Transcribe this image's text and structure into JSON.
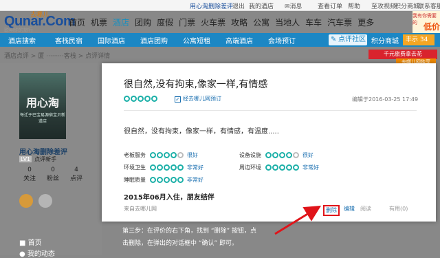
{
  "topbar": {
    "user_link": "用心淘删除差评",
    "logout": "退出",
    "my_hotel": "我的酒店",
    "messages": "消息",
    "orders": "查看订单",
    "help": "帮助",
    "video": "至攻视频",
    "points": "积分商城",
    "contact": "联系客服"
  },
  "logo": {
    "brand": "Qunar.Com",
    "camel": "去哪儿",
    "tagline": "聪明你的旅行"
  },
  "main_nav": [
    "首页",
    "机票",
    "酒店",
    "团购",
    "度假",
    "门票",
    "火车票",
    "攻略",
    "公寓",
    "当地人",
    "车车",
    "汽车票",
    "更多"
  ],
  "main_nav_active": "酒店",
  "promo": {
    "small": "我有你需要的",
    "big": "低价"
  },
  "sub_nav": {
    "items": [
      "酒店搜索",
      "客栈民宿",
      "国际酒店",
      "酒店团购",
      "公寓短租",
      "高端酒店",
      "会场预订"
    ],
    "review_community": "点评社区",
    "points_mall": "积分商城",
    "badge": "丰示 34"
  },
  "breadcrumb": "酒店点评 > 厦 ·········客栈 > 点评详情",
  "banners": {
    "red": "千元旅费拿去花",
    "orange": "去哪儿网独享"
  },
  "profile": {
    "avatar_text": "用心淘",
    "avatar_sub": "每迁于巴宝易源宿宝贝新道店",
    "name": "用心淘删除差评",
    "level_badge": "LV1",
    "level_text": "点评新手",
    "stats": [
      {
        "value": "0",
        "label": "关注"
      },
      {
        "value": "0",
        "label": "粉丝"
      },
      {
        "value": "4",
        "label": "点评"
      }
    ],
    "nav": [
      "首页",
      "我的动态"
    ]
  },
  "review": {
    "title": "很自然,没有拘束,像家一样,有情感",
    "stars": 5,
    "booked": "经去哪儿网预订",
    "edit_time": "编辑于2016-03-25 17:49",
    "body": "很自然，没有拘束，像家一样，有情感，有温度.....",
    "ratings": [
      {
        "label": "老板服务",
        "value": "很好",
        "score": 4
      },
      {
        "label": "设备设施",
        "value": "很好",
        "score": 4
      },
      {
        "label": "环境卫生",
        "value": "非常好",
        "score": 5
      },
      {
        "label": "周边环境",
        "value": "非常好",
        "score": 5
      },
      {
        "label": "睡眠质量",
        "value": "非常好",
        "score": 5
      }
    ],
    "stay": "2015年06月入住，朋友结伴",
    "from": "来自去哪儿网",
    "actions": {
      "delete": "删除",
      "edit": "编辑",
      "read": "阅读",
      "useful": "有用(0)"
    }
  },
  "caption": {
    "line1": "第三步：在评价的右下角，找到 “删除” 按钮，点",
    "line2": "击删除，在弹出的对话框中 “确认” 即可。"
  },
  "colors": {
    "accent": "#1c87c4",
    "teal": "#1cb0a8",
    "annotation": "#e0141a"
  }
}
